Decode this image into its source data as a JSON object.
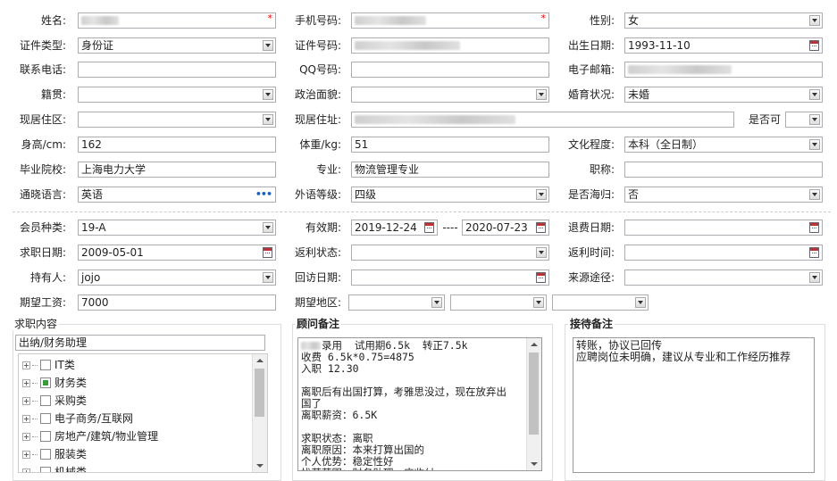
{
  "basic": {
    "name_label": "姓名:",
    "mobile_label": "手机号码:",
    "gender_label": "性别:",
    "gender_value": "女",
    "id_type_label": "证件类型:",
    "id_type_value": "身份证",
    "id_no_label": "证件号码:",
    "birth_label": "出生日期:",
    "birth_value": "1993-11-10",
    "contact_label": "联系电话:",
    "qq_label": "QQ号码:",
    "email_label": "电子邮箱:",
    "native_label": "籍贯:",
    "political_label": "政治面貌:",
    "marital_label": "婚育状况:",
    "marital_value": "未婚",
    "district_label": "现居住区:",
    "address_label": "现居住址:",
    "public_label": "是否可",
    "height_label": "身高/cm:",
    "height_value": "162",
    "weight_label": "体重/kg:",
    "weight_value": "51",
    "education_label": "文化程度:",
    "education_value": "本科（全日制）",
    "school_label": "毕业院校:",
    "school_value": "上海电力大学",
    "major_label": "专业:",
    "major_value": "物流管理专业",
    "title_label": "职称:",
    "language_label": "通晓语言:",
    "language_value": "英语",
    "lang_level_label": "外语等级:",
    "lang_level_value": "四级",
    "overseas_label": "是否海归:",
    "overseas_value": "否"
  },
  "member": {
    "type_label": "会员种类:",
    "type_value": "19-A",
    "valid_label": "有效期:",
    "valid_from": "2019-12-24",
    "valid_sep": "----",
    "valid_to": "2020-07-23",
    "refund_date_label": "退费日期:",
    "job_date_label": "求职日期:",
    "job_date_value": "2009-05-01",
    "rebate_status_label": "返利状态:",
    "rebate_time_label": "返利时间:",
    "holder_label": "持有人:",
    "holder_value": "jojo",
    "visit_date_label": "回访日期:",
    "source_label": "来源途径:",
    "salary_label": "期望工资:",
    "salary_value": "7000",
    "area_label": "期望地区:"
  },
  "job_content": {
    "legend": "求职内容",
    "selected": "出纳/财务助理",
    "tree": [
      {
        "label": "IT类",
        "checked": false
      },
      {
        "label": "财务类",
        "checked": true
      },
      {
        "label": "采购类",
        "checked": false
      },
      {
        "label": "电子商务/互联网",
        "checked": false
      },
      {
        "label": "房地产/建筑/物业管理",
        "checked": false
      },
      {
        "label": "服装类",
        "checked": false
      },
      {
        "label": "机械类",
        "checked": false
      }
    ]
  },
  "consultant": {
    "legend": "顾问备注",
    "lines": [
      "录用  试用期6.5k  转正7.5k",
      "收费 6.5k*0.75=4875",
      "入职 12.30",
      "",
      "离职后有出国打算，考雅思没过，现在放弃出",
      "国了",
      "离职薪资：6.5K",
      "",
      "求职状态：离职",
      "离职原因：本来打算出国的",
      "个人优势：稳定性好",
      "找范范围：财务助理，应收付"
    ]
  },
  "reception": {
    "legend": "接待备注",
    "lines": [
      "转账，协议已回传",
      "应聘岗位未明确，建议从专业和工作经历推荐"
    ]
  }
}
